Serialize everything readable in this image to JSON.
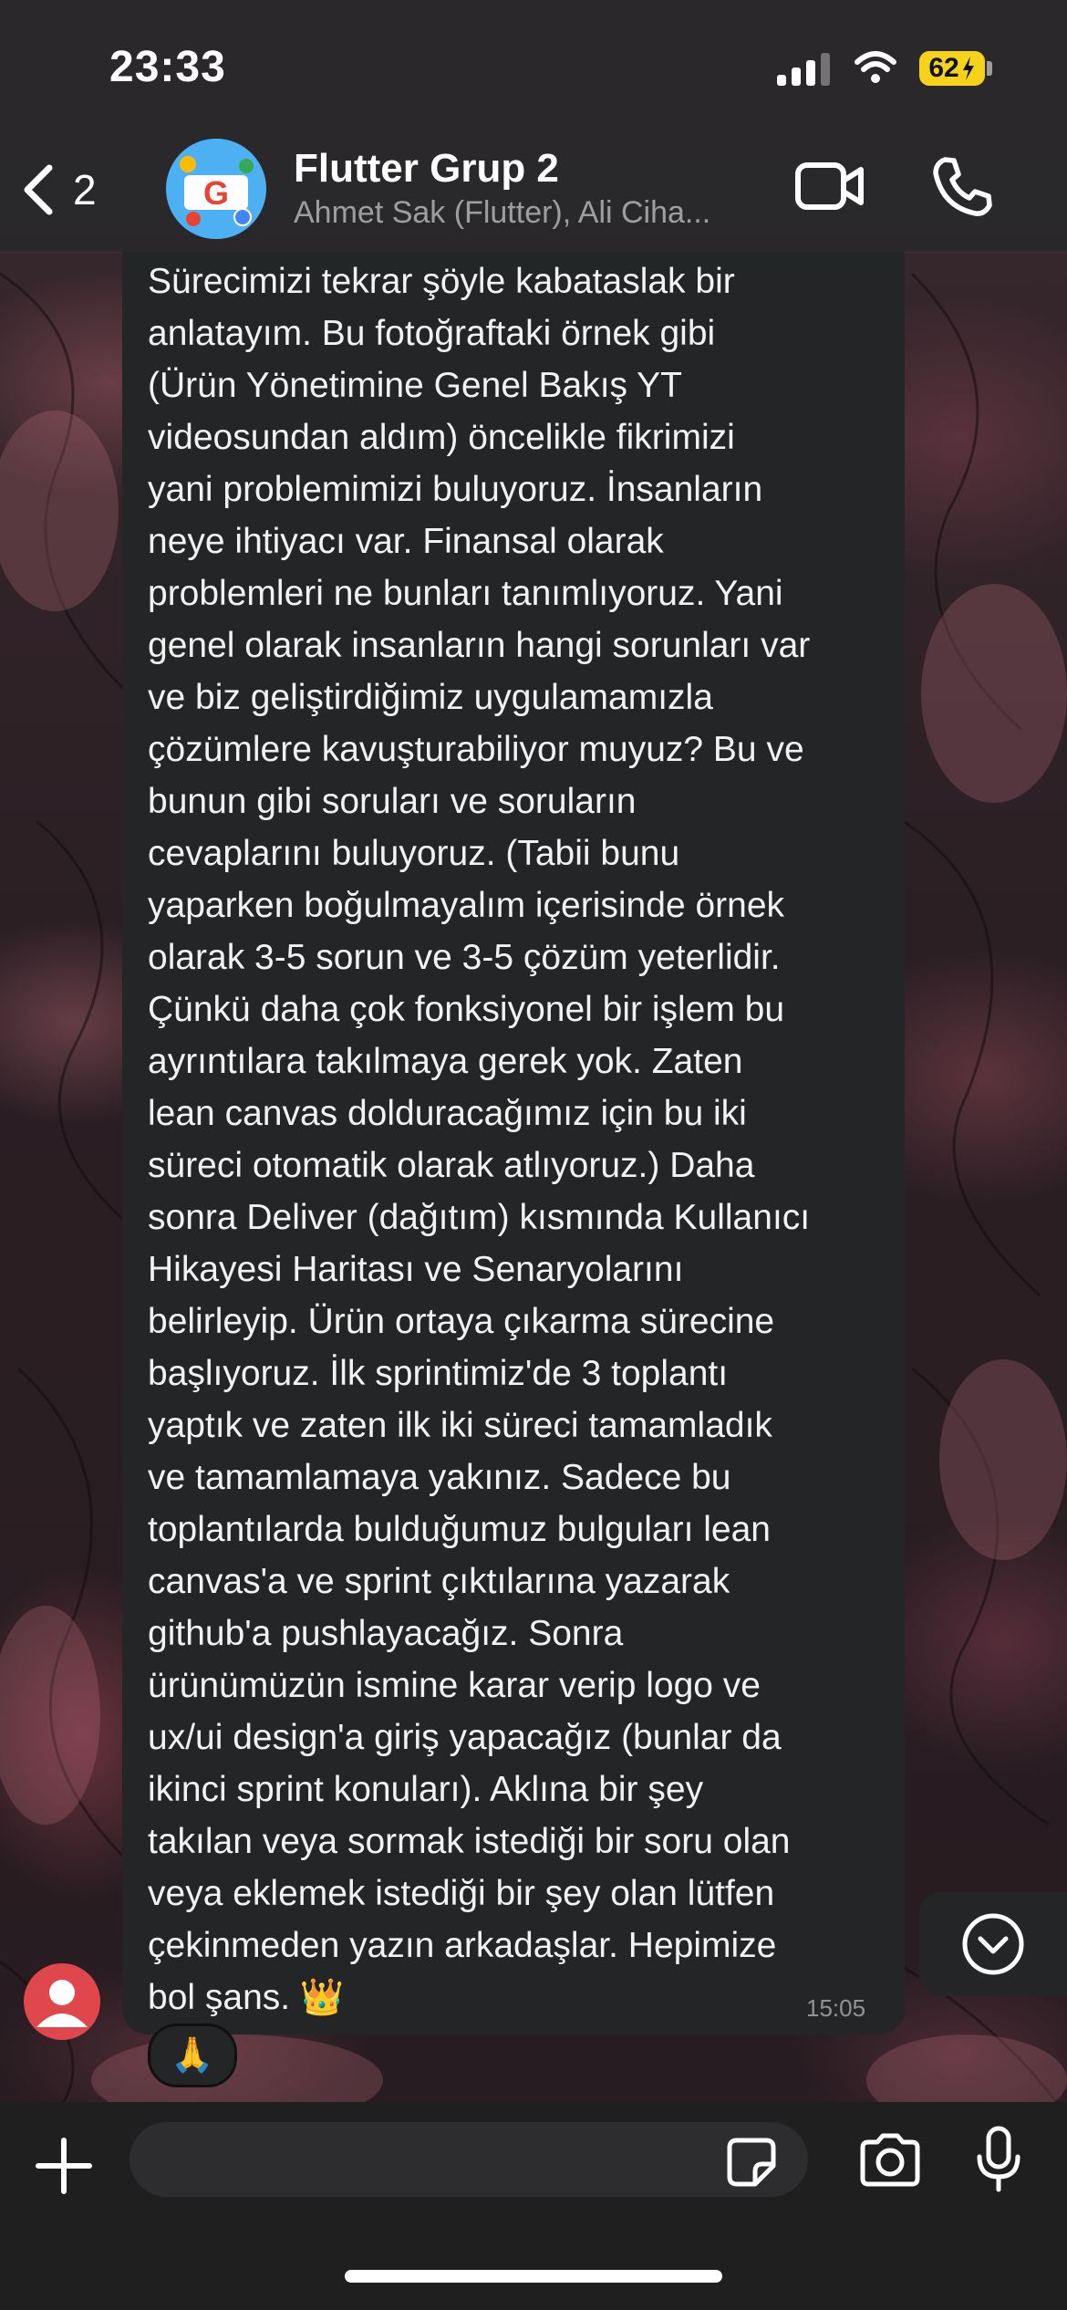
{
  "status_bar": {
    "time": "23:33",
    "battery": "62",
    "signal_bars_on": 3,
    "signal_bars_total": 4
  },
  "header": {
    "back_count": "2",
    "title": "Flutter Grup 2",
    "members": "Ahmet Sak (Flutter), Ali Ciha...",
    "video_icon": "video-camera-icon",
    "call_icon": "phone-icon"
  },
  "message": {
    "text": "Sürecimizi tekrar şöyle kabataslak bir\nanlatayım. Bu fotoğraftaki örnek gibi\n(Ürün Yönetimine Genel Bakış YT\nvideosundan aldım) öncelikle fikrimizi\nyani problemimizi buluyoruz. İnsanların\nneye ihtiyacı var. Finansal olarak\nproblemleri ne bunları tanımlıyoruz. Yani\ngenel olarak insanların hangi sorunları var\nve biz geliştirdiğimiz uygulamamızla\nçözümlere kavuşturabiliyor muyuz? Bu ve\nbunun gibi soruları ve soruların\ncevaplarını buluyoruz. (Tabii bunu\nyaparken boğulmayalım içerisinde örnek\nolarak 3-5 sorun ve 3-5 çözüm yeterlidir.\nÇünkü daha çok fonksiyonel bir işlem bu\nayrıntılara takılmaya gerek yok. Zaten\nlean canvas dolduracağımız için bu iki\nsüreci otomatik olarak atlıyoruz.) Daha\nsonra Deliver (dağıtım) kısmında Kullanıcı\nHikayesi Haritası ve Senaryolarını\nbelirleyip. Ürün ortaya çıkarma sürecine\nbaşlıyoruz. İlk sprintimiz'de 3 toplantı\nyaptık ve zaten ilk iki süreci tamamladık\nve tamamlamaya yakınız. Sadece bu\ntoplantılarda bulduğumuz bulguları lean\ncanvas'a ve sprint çıktılarına yazarak\ngithub'a pushlayacağız. Sonra\nürünümüzün ismine karar verip logo ve\nux/ui design'a giriş yapacağız (bunlar da\nikinci sprint konuları). Aklına bir şey\ntakılan veya sormak istediği bir soru olan\nveya eklemek istediği bir şey olan lütfen\nçekinmeden yazın arkadaşlar. Hepimize\nbol şans. 👑",
    "time": "15:05",
    "reaction": "🙏"
  },
  "composer": {
    "input_value": "",
    "input_placeholder": ""
  },
  "colors": {
    "bubble": "#232526",
    "bar": "#28282a",
    "battery": "#f7d21b",
    "sender_avatar": "#e0474c"
  }
}
